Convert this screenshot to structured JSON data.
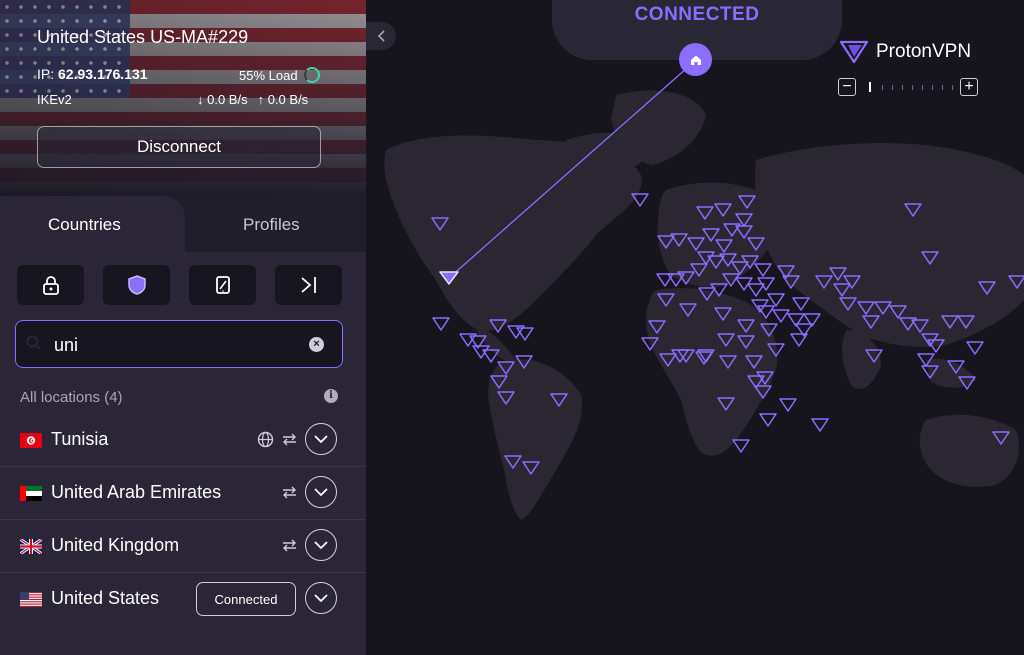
{
  "header": {
    "server_name": "United States US-MA#229",
    "ip_label": "IP:",
    "ip_value": "62.93.176.131",
    "load": "55% Load",
    "protocol": "IKEv2",
    "download_speed": "0.0 B/s",
    "upload_speed": "0.0 B/s",
    "disconnect_label": "Disconnect"
  },
  "tabs": [
    {
      "label": "Countries",
      "active": true
    },
    {
      "label": "Profiles",
      "active": false
    }
  ],
  "search": {
    "value": "uni",
    "placeholder": ""
  },
  "locations": {
    "label": "All locations (4)",
    "items": [
      {
        "name": "Tunisia",
        "flag": "tunisia-flag",
        "features": [
          "globe-icon",
          "p2p-icon"
        ]
      },
      {
        "name": "United Arab Emirates",
        "flag": "uae-flag",
        "features": [
          "p2p-icon"
        ]
      },
      {
        "name": "United Kingdom",
        "flag": "uk-flag",
        "features": [
          "p2p-icon"
        ]
      },
      {
        "name": "United States",
        "flag": "us-flag",
        "features": [],
        "status_badge": "Connected"
      }
    ]
  },
  "map": {
    "status": "CONNECTED",
    "brand": "ProtonVPN"
  },
  "colors": {
    "accent": "#8b6dff",
    "sidebar": "#211e2c",
    "panel": "#2a2637",
    "map_bg": "#16141c"
  }
}
